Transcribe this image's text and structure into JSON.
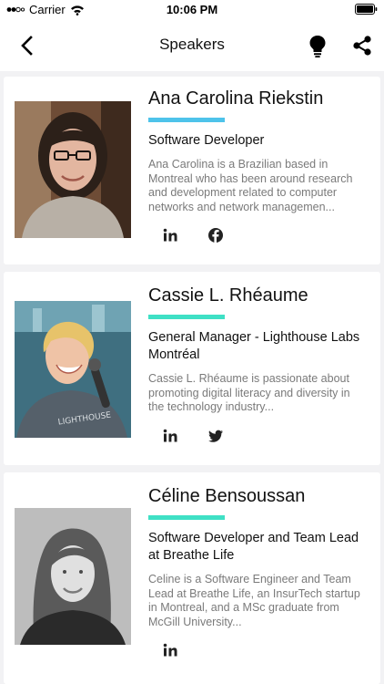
{
  "status_bar": {
    "carrier": "Carrier",
    "time": "10:06 PM"
  },
  "nav": {
    "title": "Speakers",
    "icons": [
      "chevron-left-icon",
      "lightbulb-icon",
      "share-icon"
    ]
  },
  "colors": {
    "accent_blue": "#4ec3ea",
    "accent_teal": "#3fe0c5",
    "text_primary": "#111111",
    "text_secondary": "#7a7a7a"
  },
  "speakers": [
    {
      "name": "Ana Carolina Riekstin",
      "role": "Software Developer",
      "bio": "Ana Carolina is a Brazilian based in Montreal who has been around research and development related to computer networks and network managemen...",
      "accent": "#4ec3ea",
      "socials": [
        "linkedin-icon",
        "facebook-icon"
      ]
    },
    {
      "name": "Cassie L. Rhéaume",
      "role": "General Manager - Lighthouse Labs Montréal",
      "bio": "Cassie L. Rhéaume is passionate about promoting digital literacy and diversity in the technology industry...",
      "accent": "#3fe0c5",
      "socials": [
        "linkedin-icon",
        "twitter-icon"
      ]
    },
    {
      "name": "Céline Bensoussan",
      "role": "Software Developer and Team Lead at Breathe Life",
      "bio": "Celine is a Software Engineer and Team Lead at Breathe Life, an InsurTech startup in Montreal, and a MSc graduate from McGill University...",
      "accent": "#3fe0c5",
      "socials": [
        "linkedin-icon"
      ]
    }
  ]
}
